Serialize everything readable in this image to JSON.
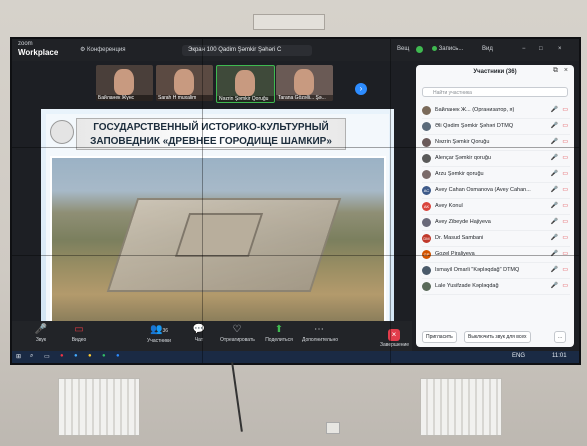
{
  "app": {
    "brand_line1": "zoom",
    "brand_line2": "Workplace",
    "conference_tab": "Конференция",
    "meeting_title": "Экран 100 Qadim Şəmkir Şəhəri C",
    "top_right": [
      "Вещ",
      "Запись...",
      "Вид"
    ],
    "window_controls": [
      "−",
      "□",
      "×"
    ]
  },
  "thumbnails": [
    {
      "name": "Байланек Жүнс"
    },
    {
      "name": "Sarah H muxalim"
    },
    {
      "name": "Nəzrin Şəmkir Qoruğu"
    },
    {
      "name": "Tarana Gözəlli... Şə..."
    }
  ],
  "slide": {
    "title_line1": "ГОСУДАРСТВЕННЫЙ ИСТОРИКО-КУЛЬТУРНЫЙ",
    "title_line2": "ЗАПОВЕДНИК «ДРЕВНЕЕ ГОРОДИЩЕ ШАМКИР»"
  },
  "toolbar": [
    {
      "icon": "🎤",
      "label": "Звук"
    },
    {
      "icon": "▭",
      "label": "Видео"
    },
    {
      "icon": "👥",
      "label": "Участники",
      "badge": "36"
    },
    {
      "icon": "💬",
      "label": "Чат"
    },
    {
      "icon": "♡",
      "label": "Отреагировать"
    },
    {
      "icon": "⬆",
      "label": "Поделиться"
    },
    {
      "icon": "⋯",
      "label": "Дополнительно"
    }
  ],
  "end_label": "Завершение",
  "participants": {
    "header": "Участники (36)",
    "search_placeholder": "Найти участника",
    "list": [
      {
        "name": "Байланек Ж... (Организатор, я)",
        "avatar": "",
        "color": "#7a6a5a"
      },
      {
        "name": "Əli Qədim Şəmkir Şəhəri DTMQ",
        "avatar": "",
        "color": "#5a6a7a"
      },
      {
        "name": "Nəzrin Şəmkir Qoruğu",
        "avatar": "",
        "color": "#6a5a5a"
      },
      {
        "name": "Alençar Şəmkir qoruğu",
        "avatar": "",
        "color": "#5a5a5a"
      },
      {
        "name": "Arzu Şəmkir qoruğu",
        "avatar": "",
        "color": "#7a6a6a"
      },
      {
        "name": "Avey Cahan Osmanova (Avey Cahan...",
        "avatar": "AC",
        "color": "#3d5a8a"
      },
      {
        "name": "Avey Konul",
        "avatar": "AK",
        "color": "#d9453d"
      },
      {
        "name": "Avey Zibeyde Hajiyeva",
        "avatar": "",
        "color": "#6a6a7a"
      },
      {
        "name": "Dr. Masud Sambani",
        "avatar": "DM",
        "color": "#c0392b"
      },
      {
        "name": "Gozel Piraliyeva",
        "avatar": "GP",
        "color": "#d35400"
      },
      {
        "name": "Ismayil Omarli \"Kəpləqdağ\" DTMQ",
        "avatar": "",
        "color": "#4a5a6a"
      },
      {
        "name": "Lale Yusifzade Kəpləqdağ",
        "avatar": "",
        "color": "#5a6a5a"
      }
    ],
    "invite_label": "Пригласить",
    "mute_all_label": "Выключить звук для всех",
    "more_label": "..."
  },
  "taskbar": {
    "lang": "ENG",
    "time": "11:01"
  }
}
